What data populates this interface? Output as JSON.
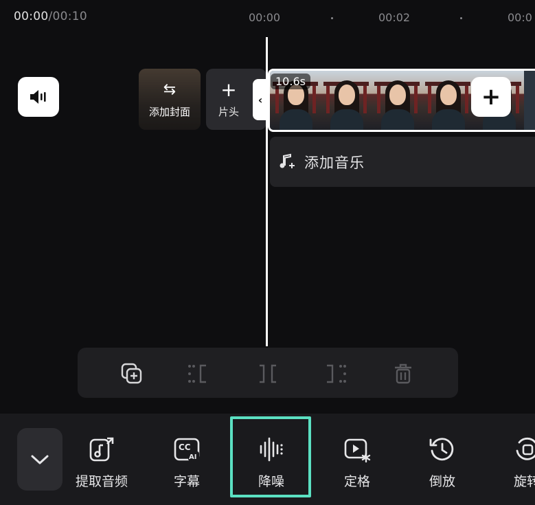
{
  "timeline": {
    "current_time": "00:00",
    "total_time": "/00:10",
    "ticks": [
      "00:00",
      "00:02",
      "00:0"
    ]
  },
  "cover": {
    "label": "添加封面"
  },
  "intro": {
    "label": "片头"
  },
  "clip": {
    "duration": "10.6s"
  },
  "music": {
    "label": "添加音乐"
  },
  "actions": [
    {
      "label": "提取音频",
      "icon": "extract-audio-icon"
    },
    {
      "label": "字幕",
      "icon": "cc-ai-icon"
    },
    {
      "label": "降噪",
      "icon": "denoise-waveform-icon"
    },
    {
      "label": "定格",
      "icon": "freeze-frame-icon"
    },
    {
      "label": "倒放",
      "icon": "reverse-clock-icon"
    },
    {
      "label": "旋转",
      "icon": "rotate-icon"
    }
  ],
  "colors": {
    "highlight": "#5be0c2",
    "background": "#0e0e10"
  }
}
